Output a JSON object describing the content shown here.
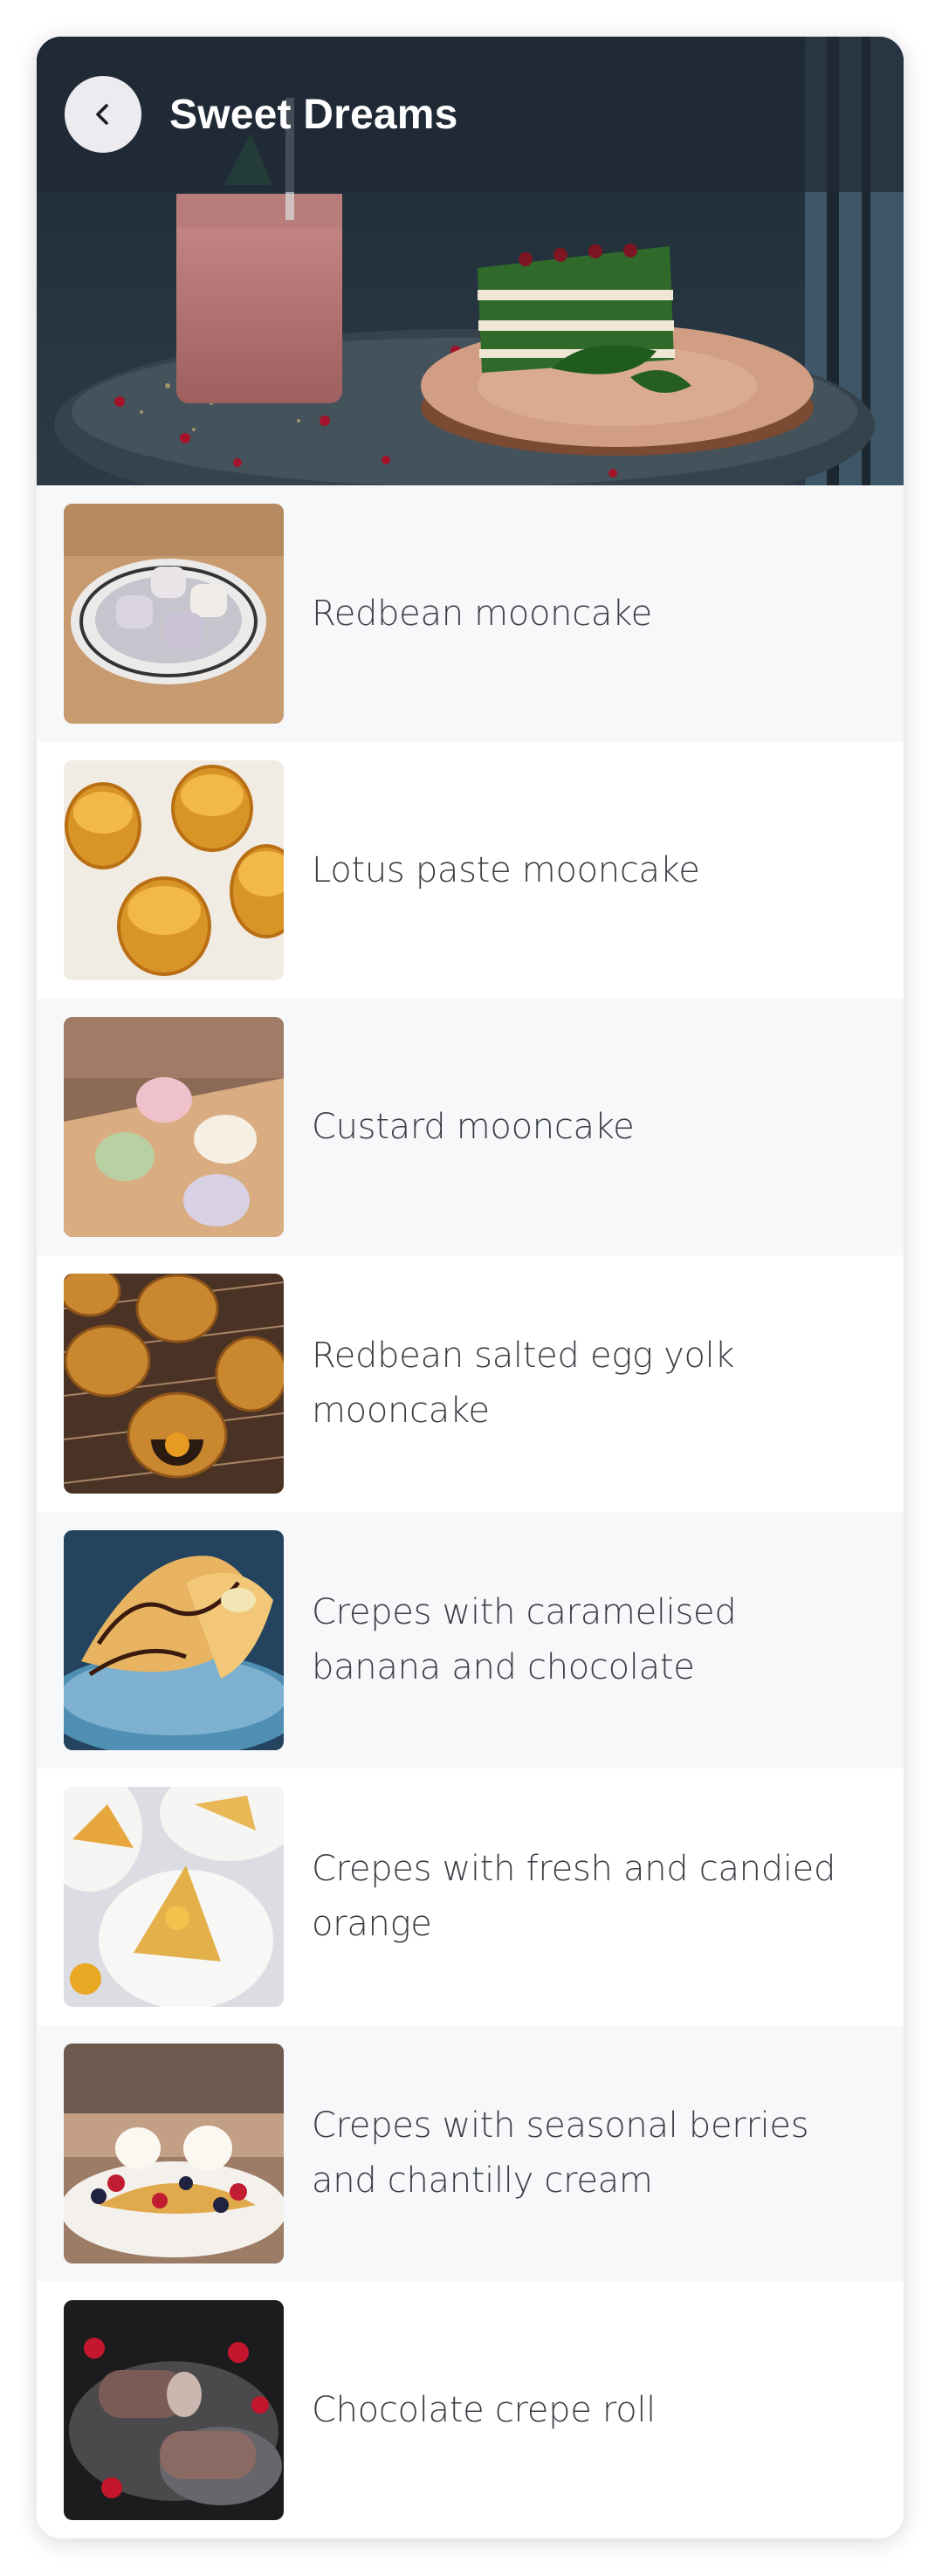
{
  "header": {
    "title": "Sweet Dreams",
    "back_icon": "chevron-left-icon"
  },
  "items": [
    {
      "label": "Redbean mooncake"
    },
    {
      "label": "Lotus paste mooncake"
    },
    {
      "label": "Custard mooncake"
    },
    {
      "label": "Redbean salted egg yolk mooncake"
    },
    {
      "label": "Crepes with caramelised banana and chocolate"
    },
    {
      "label": "Crepes with fresh and candied orange"
    },
    {
      "label": "Crepes with seasonal berries and chantilly cream"
    },
    {
      "label": "Chocolate crepe roll"
    }
  ],
  "colors": {
    "row_alt": "#f7f8fa",
    "appbar": "#202a36",
    "text": "#3a3d44"
  }
}
